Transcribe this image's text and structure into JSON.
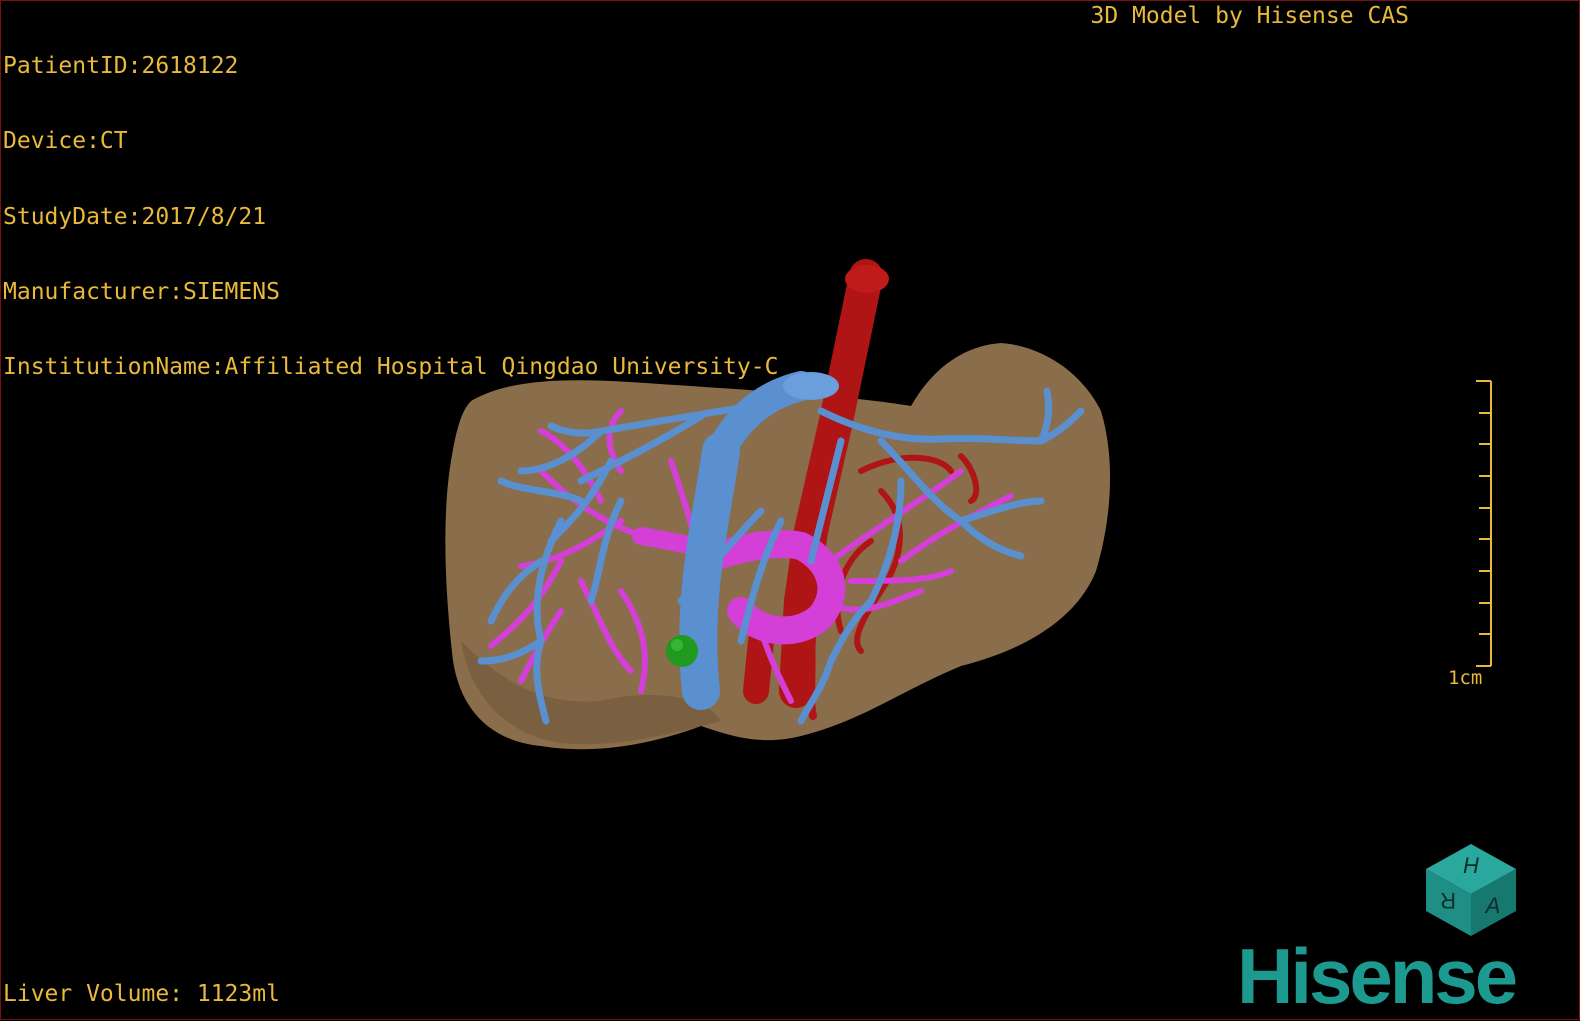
{
  "study_info": {
    "patient_id": "PatientID:2618122",
    "device": "Device:CT",
    "study_date": "StudyDate:2017/8/21",
    "manufacturer": "Manufacturer:SIEMENS",
    "institution": "InstitutionName:Affiliated Hospital Qingdao University-C"
  },
  "header_brand": "3D Model by Hisense CAS",
  "liver_volume": "Liver Volume: 1123ml",
  "scale_bar": {
    "label": "1cm"
  },
  "orientation_cube": {
    "faces": [
      "H",
      "R",
      "A"
    ],
    "color": "#1f8f86"
  },
  "logo": "Hisense",
  "colors": {
    "text": "#e8b93a",
    "liver": "#8a6d4a",
    "hepatic_vein": "#5a8fd0",
    "portal_vein": "#d43fd8",
    "artery": "#b01515",
    "lesion": "#1f9a1f",
    "brand": "#1d9a8f"
  }
}
